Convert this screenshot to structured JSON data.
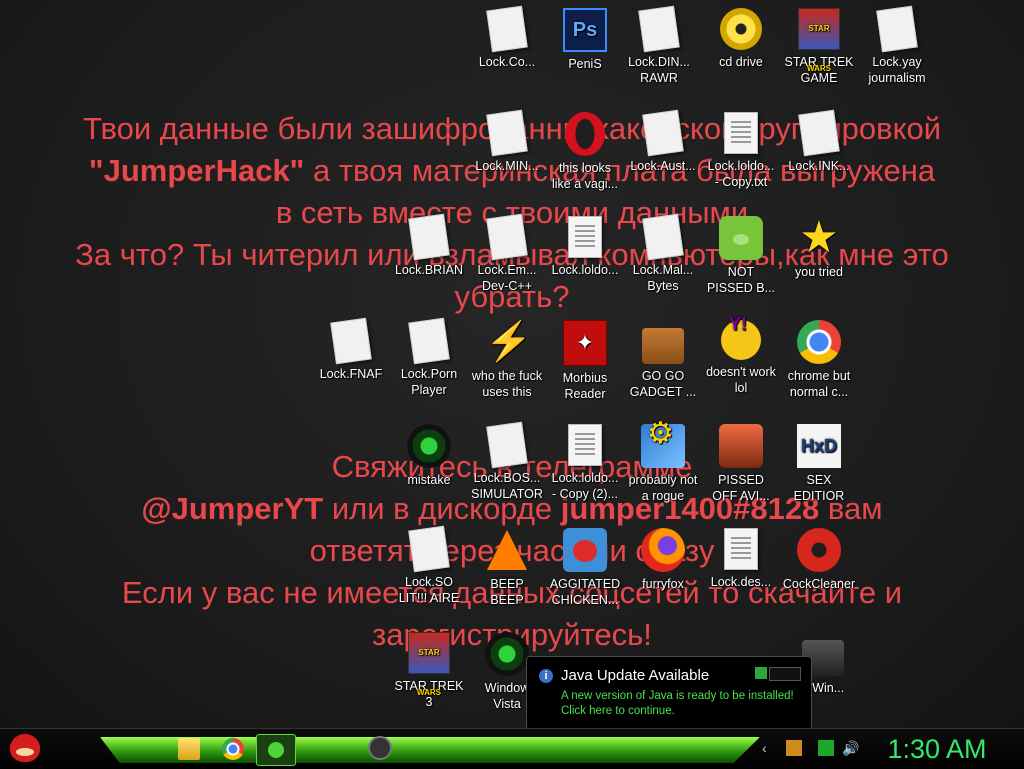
{
  "wallpaper": {
    "line1": "Твои данные были зашифрованны хакерской группировкой",
    "line2_bold": "\"JumperHack\"",
    "line2_rest": " а твоя материнская плата была выгружена",
    "line3": "в сеть вместе с твоими данными",
    "line4": "За что? Ты читерил или взламывал компьютеры,как мне это",
    "line5": "убрать?",
    "line6": "Свяжитесь в телеграмме",
    "line7_bold1": "@JumperYT",
    "line7_mid": " или в дискорде ",
    "line7_bold2": "jumper1400#8128",
    "line7_end": " вам",
    "line8": "ответят через час или сразу",
    "line9": "Если у вас не имеется данных соцсетей то скачайте и",
    "line10": "зарегистрируйтесь!"
  },
  "icons": [
    {
      "label": "Lock.Co...",
      "icon": "blank-file-icon"
    },
    {
      "label": "PeniS",
      "icon": "photoshop-icon"
    },
    {
      "label": "Lock.DIN...\nRAWR",
      "icon": "blank-file-icon"
    },
    {
      "label": "cd drive",
      "icon": "cd-drive-icon"
    },
    {
      "label": "STAR TREK\nGAME",
      "icon": "star-wars-game-icon"
    },
    {
      "label": "Lock.yay\njournalism",
      "icon": "blank-file-icon"
    },
    {
      "label": "Lock.MIN...",
      "icon": "blank-file-icon"
    },
    {
      "label": "this looks\nlike a vagi...",
      "icon": "opera-icon"
    },
    {
      "label": "Lock.Aust...",
      "icon": "blank-file-icon"
    },
    {
      "label": "Lock.loldo...\n- Copy.txt",
      "icon": "text-file-icon"
    },
    {
      "label": "Lock.INK...",
      "icon": "blank-file-icon"
    },
    {
      "label": "Lock.BRIAN",
      "icon": "blank-file-icon"
    },
    {
      "label": "Lock.Em...\nDev-C++",
      "icon": "blank-file-icon"
    },
    {
      "label": "Lock.loldo...",
      "icon": "text-file-icon"
    },
    {
      "label": "Lock.Mal...\nBytes",
      "icon": "blank-file-icon"
    },
    {
      "label": "NOT\nPISSED B...",
      "icon": "bad-piggies-icon"
    },
    {
      "label": "you tried",
      "icon": "gold-star-icon"
    },
    {
      "label": "Lock.FNAF",
      "icon": "blank-file-icon"
    },
    {
      "label": "Lock.Porn\nPlayer",
      "icon": "blank-file-icon"
    },
    {
      "label": "who the fuck\nuses this",
      "icon": "lightning-icon"
    },
    {
      "label": "Morbius\nReader",
      "icon": "pdf-reader-icon"
    },
    {
      "label": "GO GO\nGADGET ...",
      "icon": "briefcase-icon"
    },
    {
      "label": "doesn't work\nlol",
      "icon": "yahoo-messenger-icon"
    },
    {
      "label": "chrome but\nnormal c...",
      "icon": "chrome-icon"
    },
    {
      "label": "mistake",
      "icon": "green-disc-icon"
    },
    {
      "label": "Lock.BOS...\nSIMULATOR",
      "icon": "blank-file-icon"
    },
    {
      "label": "Lock.loldo...\n- Copy (2)...",
      "icon": "text-file-icon"
    },
    {
      "label": "probably not\na rogue",
      "icon": "system-tools-icon"
    },
    {
      "label": "PISSED\nOFF AVI...",
      "icon": "angry-birds-seasons-icon"
    },
    {
      "label": "SEX\nEDITIOR",
      "icon": "hxd-icon"
    },
    {
      "label": "Lock.SO\nLIT!!! AIRE",
      "icon": "blank-file-icon"
    },
    {
      "label": "BEEP\nBEEP",
      "icon": "vlc-icon"
    },
    {
      "label": "AGGITATED\nCHICKEN...",
      "icon": "angry-birds-icon"
    },
    {
      "label": "furryfox",
      "icon": "firefox-icon"
    },
    {
      "label": "Lock.des...",
      "icon": "text-file-icon"
    },
    {
      "label": "CockCleaner",
      "icon": "ccleaner-icon"
    },
    {
      "label": "STAR TREK\n3",
      "icon": "star-wars-game-icon"
    },
    {
      "label": "Window\nVista",
      "icon": "recycle-bin-icon"
    },
    {
      "label": "...Win...",
      "icon": "shortcut-icon"
    }
  ],
  "notification": {
    "title": "Java Update Available",
    "message": "A new version of Java is ready to be installed!\nClick here to continue."
  },
  "taskbar": {
    "clock": "1:30 AM"
  },
  "colors": {
    "wallpaper_text": "#e8484c",
    "clock": "#35e86a",
    "notification_message": "#48e04b",
    "taskbar_accent": "#2c9a0e"
  }
}
